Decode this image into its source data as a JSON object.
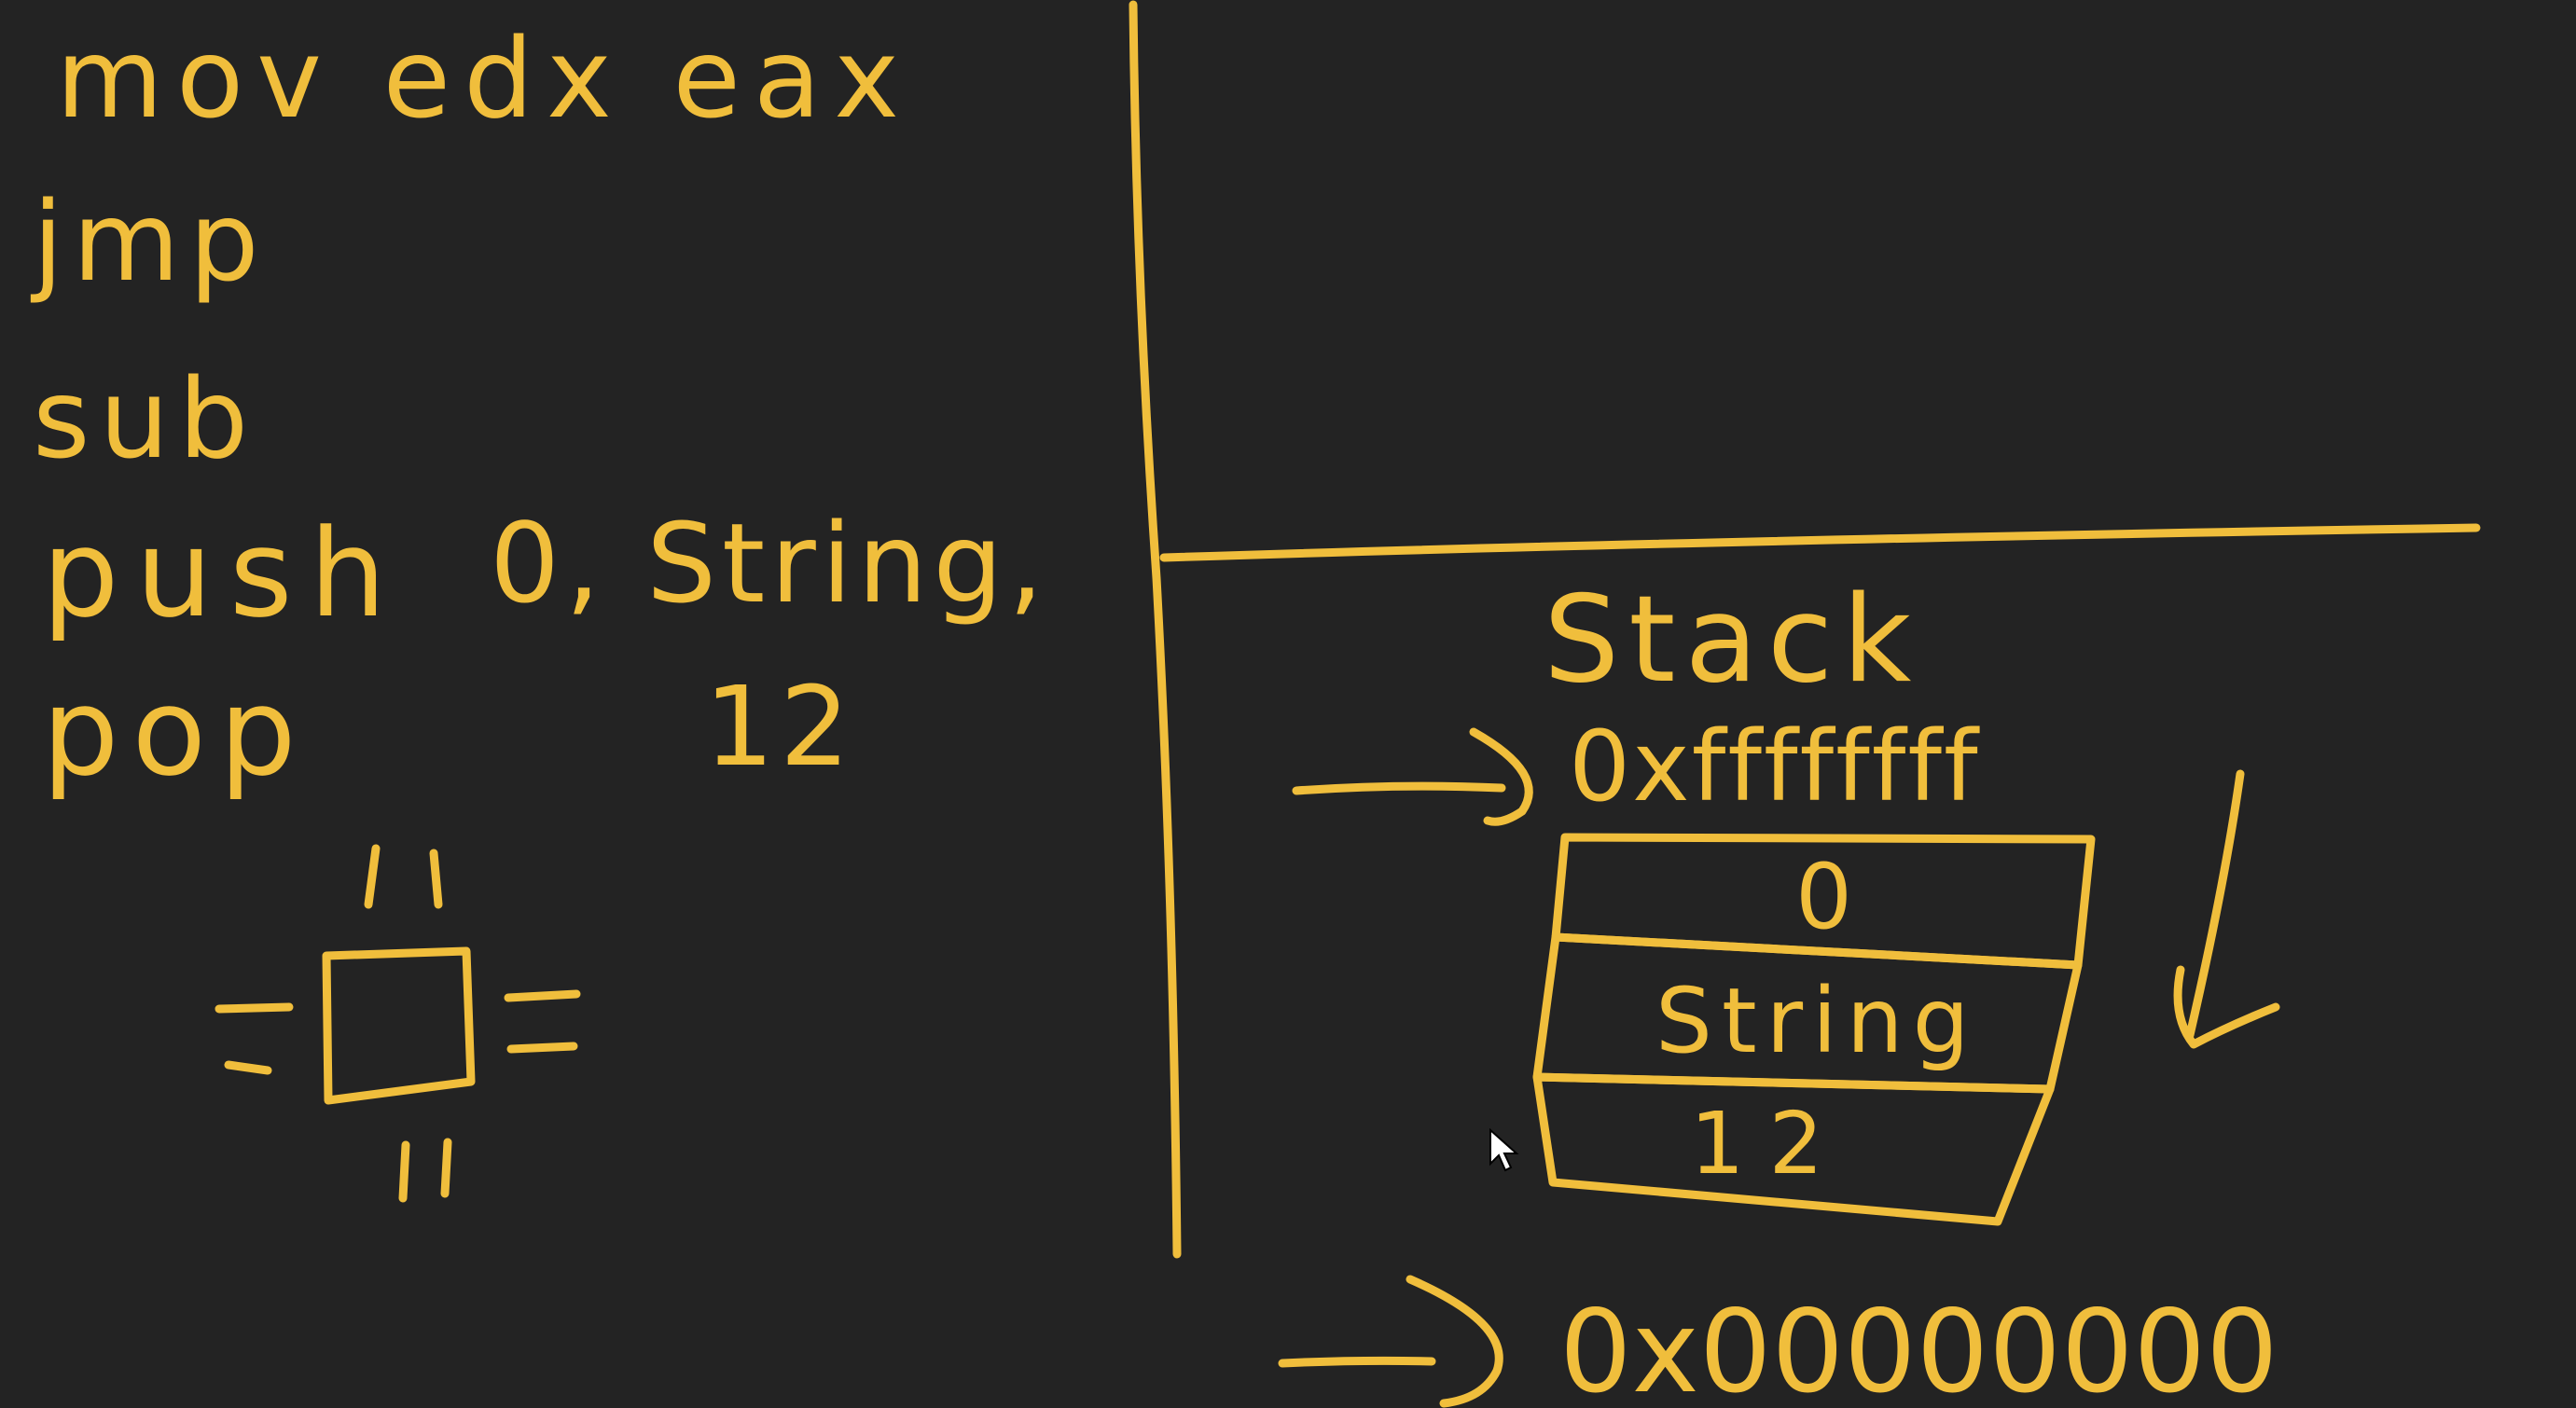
{
  "canvas": {
    "background": "#232323",
    "ink_color": "#f0be3c"
  },
  "instructions": {
    "mov": "mov edx eax",
    "jmp": "jmp",
    "sub": "sub",
    "push": "push",
    "push_args": "0, String,",
    "pop": "pop",
    "pop_arg": "12"
  },
  "stack_panel": {
    "title": "Stack",
    "top_address": "0xffffffff",
    "bottom_address": "0x00000000",
    "cells": [
      "0",
      "String",
      "12"
    ]
  },
  "cursor": {
    "icon": "mouse-pointer-icon"
  }
}
